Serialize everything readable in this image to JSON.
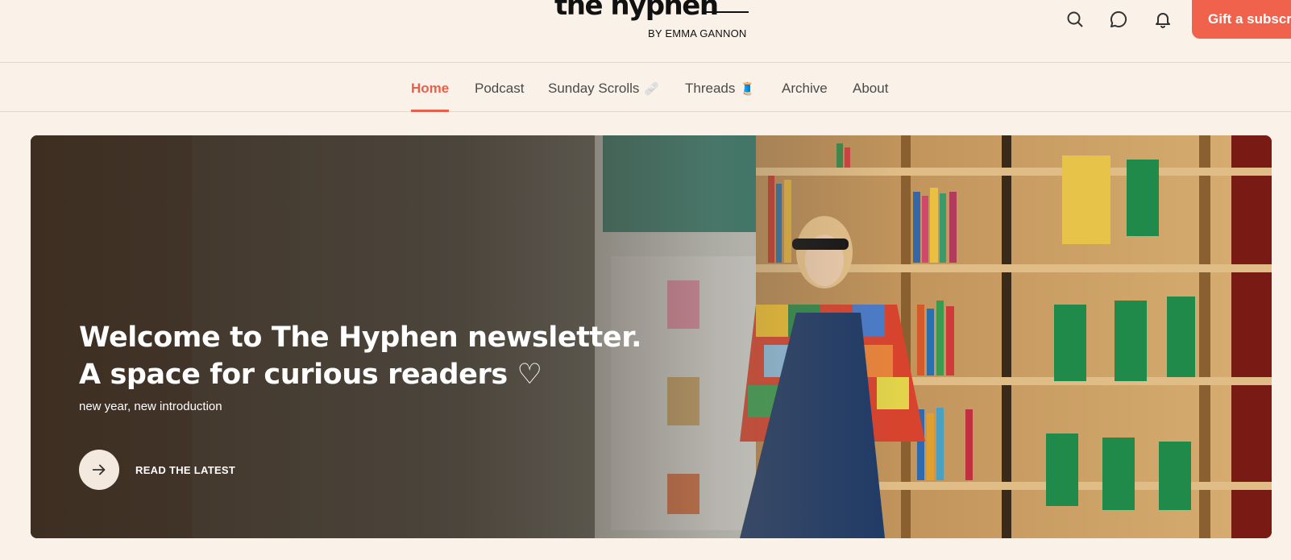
{
  "header": {
    "logo_title": "the hyphen",
    "logo_subtitle": "BY EMMA GANNON",
    "icons": [
      "search-icon",
      "chat-bubble-icon",
      "bell-icon"
    ],
    "gift_button": "Gift a subscription"
  },
  "nav": {
    "items": [
      {
        "label": "Home",
        "active": true
      },
      {
        "label": "Podcast"
      },
      {
        "label": "Sunday Scrolls",
        "emoji": "🩹"
      },
      {
        "label": "Threads",
        "emoji": "🧵"
      },
      {
        "label": "Archive"
      },
      {
        "label": "About"
      }
    ]
  },
  "hero": {
    "title_line1": "Welcome to The Hyphen newsletter.",
    "title_line2": "A space for curious readers ♡",
    "subtitle": "new year, new introduction",
    "cta_label": "READ THE LATEST",
    "cta_icon": "arrow-right-icon"
  },
  "colors": {
    "background": "#faf1e8",
    "accent": "#f0624b",
    "active_nav": "#e8604a"
  }
}
